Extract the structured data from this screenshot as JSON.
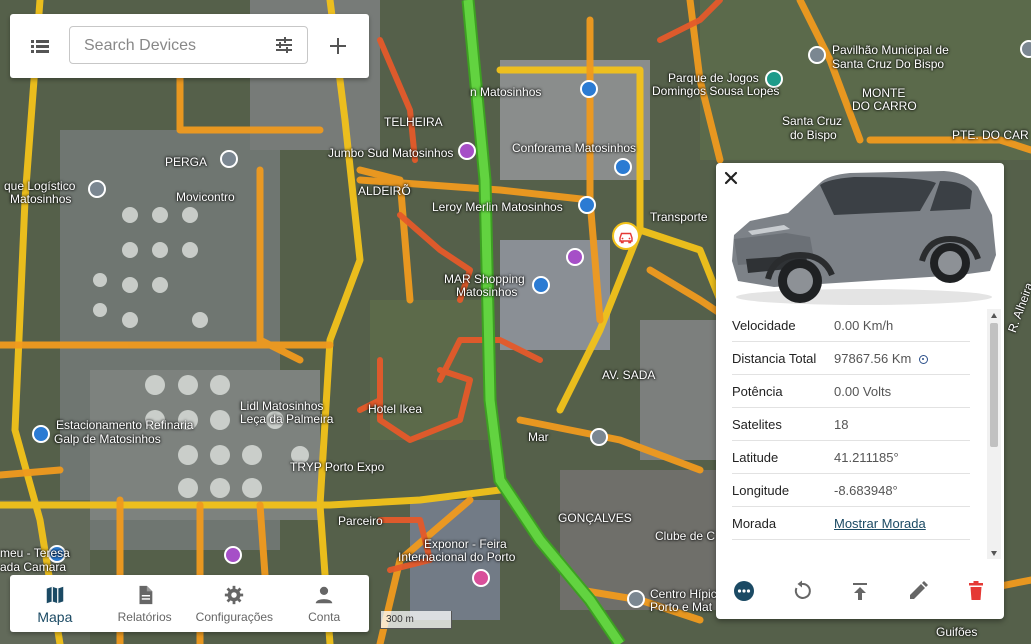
{
  "search": {
    "placeholder": "Search Devices"
  },
  "icons": {
    "menu": "list-icon",
    "filter": "tune-icon",
    "add": "plus-icon",
    "close": "close-icon",
    "map": "map-icon",
    "reports": "description-icon",
    "settings": "gear-icon",
    "account": "person-icon",
    "more": "more-horizontal-icon",
    "replay": "replay-icon",
    "publish": "publish-icon",
    "edit": "pencil-icon",
    "delete": "trash-icon"
  },
  "colors": {
    "accent": "#1b4a64",
    "delete": "#e53935",
    "more": "#1b4a64",
    "route_green": "#53c234",
    "route_orange": "#f2a51a",
    "route_red": "#e8542a"
  },
  "nav": [
    {
      "label": "Mapa",
      "active": true
    },
    {
      "label": "Relatórios",
      "active": false
    },
    {
      "label": "Configurações",
      "active": false
    },
    {
      "label": "Conta",
      "active": false
    }
  ],
  "scale": {
    "label": "300 m"
  },
  "map_labels": [
    "Pavilhão Municipal de",
    "Santa Cruz Do Bispo",
    "Parque de Jogos",
    "Domingos Sousa Lopes",
    "MONTE",
    "DO CARRO",
    "Santa Cruz",
    "do Bispo",
    "PTE. DO CAR",
    "n Matosinhos",
    "TELHEIRA",
    "PERGA",
    "Jumbo Sud Matosinhos",
    "que Logístico",
    "Matosinhos",
    "Movicontro",
    "ALDEIRÕ",
    "Conforama Matosinhos",
    "Leroy Merlin Matosinhos",
    "Transporte",
    "MAR Shopping",
    "Matosinhos",
    "AV. SADA",
    "Estacionamento Refinaria",
    "Galp de Matosinhos",
    "Lidl Matosinhos",
    "Leça da Palmeira",
    "Hotel Ikea",
    "Mar",
    "TRYP Porto Expo",
    "Parceiro",
    "Exponor - Feira",
    "Internacional do Porto",
    "GONÇALVES",
    "Clube de C",
    "Centro Hípico",
    "Porto e Mat",
    "Guifões",
    "meu - Teresa",
    "ada Camara",
    "R. Alheira"
  ],
  "device": {
    "image_alt": "grey compact electric SUV",
    "attributes": [
      {
        "key": "Velocidade",
        "value": "0.00 Km/h"
      },
      {
        "key": "Distancia Total",
        "value": "97867.56 Km"
      },
      {
        "key": "Potência",
        "value": "0.00 Volts"
      },
      {
        "key": "Satelites",
        "value": "18"
      },
      {
        "key": "Latitude",
        "value": "41.211185°"
      },
      {
        "key": "Longitude",
        "value": "-8.683948°"
      },
      {
        "key": "Morada",
        "value": "Mostrar Morada"
      }
    ]
  }
}
